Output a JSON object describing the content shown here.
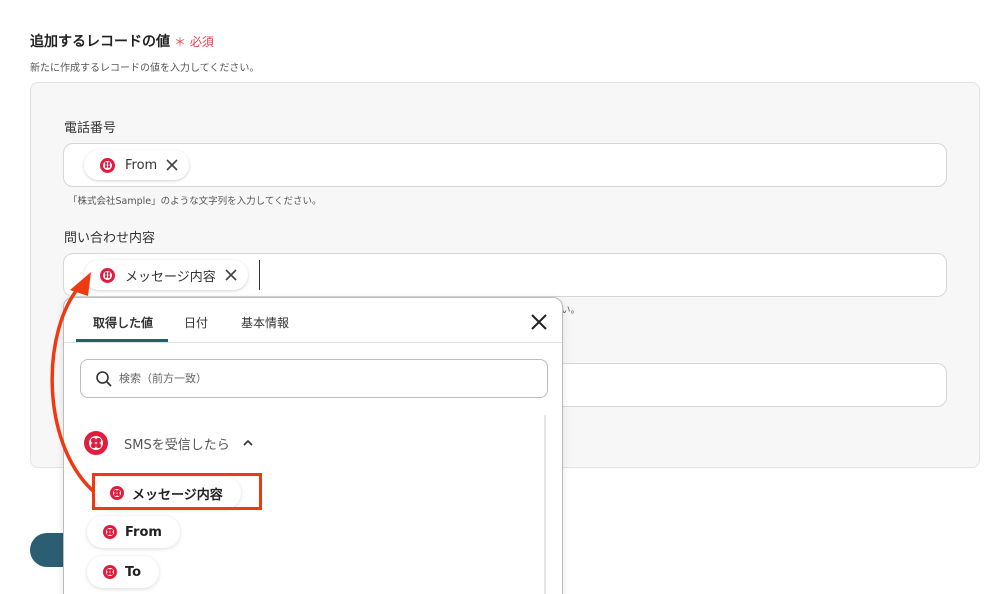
{
  "section": {
    "title": "追加するレコードの値",
    "required_mark": "＊ 必須",
    "description": "新たに作成するレコードの値を入力してください。"
  },
  "fields": [
    {
      "label": "電話番号",
      "tag": "From",
      "hint": "「株式会社Sample」のような文字列を入力してください。"
    },
    {
      "label": "問い合わせ内容",
      "tag": "メッセージ内容",
      "hint_visible_tail": "い。"
    }
  ],
  "picker": {
    "tabs": [
      "取得した値",
      "日付",
      "基本情報"
    ],
    "active_tab": "取得した値",
    "search_placeholder": "検索（前方一致）",
    "group_label": "SMSを受信したら",
    "items": [
      "メッセージ内容",
      "From",
      "To"
    ],
    "highlighted_item": "メッセージ内容"
  },
  "icons": {
    "service": "twilio-icon",
    "remove": "close-icon",
    "collapse": "chevron-up-icon",
    "search": "search-icon"
  },
  "colors": {
    "twilio_red": "#e31c3d",
    "highlight_orange": "#ee3a13",
    "accent_teal": "#1f6170",
    "required_red": "#e5484d"
  }
}
